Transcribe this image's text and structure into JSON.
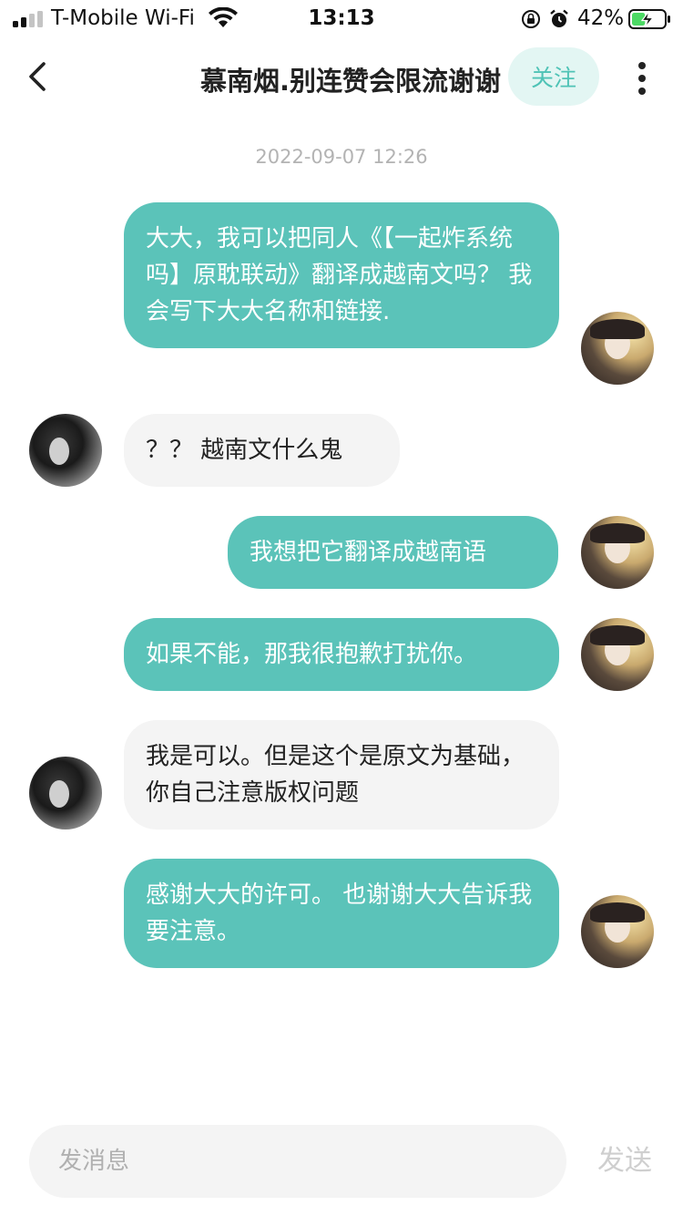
{
  "status_bar": {
    "carrier": "T-Mobile Wi-Fi",
    "time": "13:13",
    "battery_percent": "42%",
    "signal_bars": 2,
    "battery_level": 0.42,
    "battery_color": "#4cd964",
    "icons": [
      "signal-icon",
      "wifi-icon",
      "orientation-lock-icon",
      "alarm-icon",
      "battery-charging-icon"
    ]
  },
  "nav": {
    "title": "慕南烟.别连赞会限流谢谢",
    "follow_label": "关注",
    "icons": [
      "back-arrow-icon",
      "more-vertical-icon"
    ]
  },
  "chat": {
    "timestamp": "2022-09-07 12:26",
    "messages": [
      {
        "sender": "me",
        "text": "大大，我可以把同人《【一起炸系统吗】原耽联动》翻译成越南文吗？ 我会写下大大名称和链接."
      },
      {
        "sender": "other",
        "text": "？？ 越南文什么鬼"
      },
      {
        "sender": "me",
        "text": "我想把它翻译成越南语"
      },
      {
        "sender": "me",
        "text": "如果不能，那我很抱歉打扰你。"
      },
      {
        "sender": "other",
        "text": "我是可以。但是这个是原文为基础，你自己注意版权问题"
      },
      {
        "sender": "me",
        "text": "感谢大大的许可。 也谢谢大大告诉我要注意。"
      }
    ]
  },
  "input_bar": {
    "placeholder": "发消息",
    "value": "",
    "send_label": "发送"
  },
  "colors": {
    "sent_bubble": "#5bc3b9",
    "received_bubble": "#f4f4f4",
    "follow_button_bg": "#e3f6f3",
    "follow_button_text": "#4fc3b6"
  }
}
